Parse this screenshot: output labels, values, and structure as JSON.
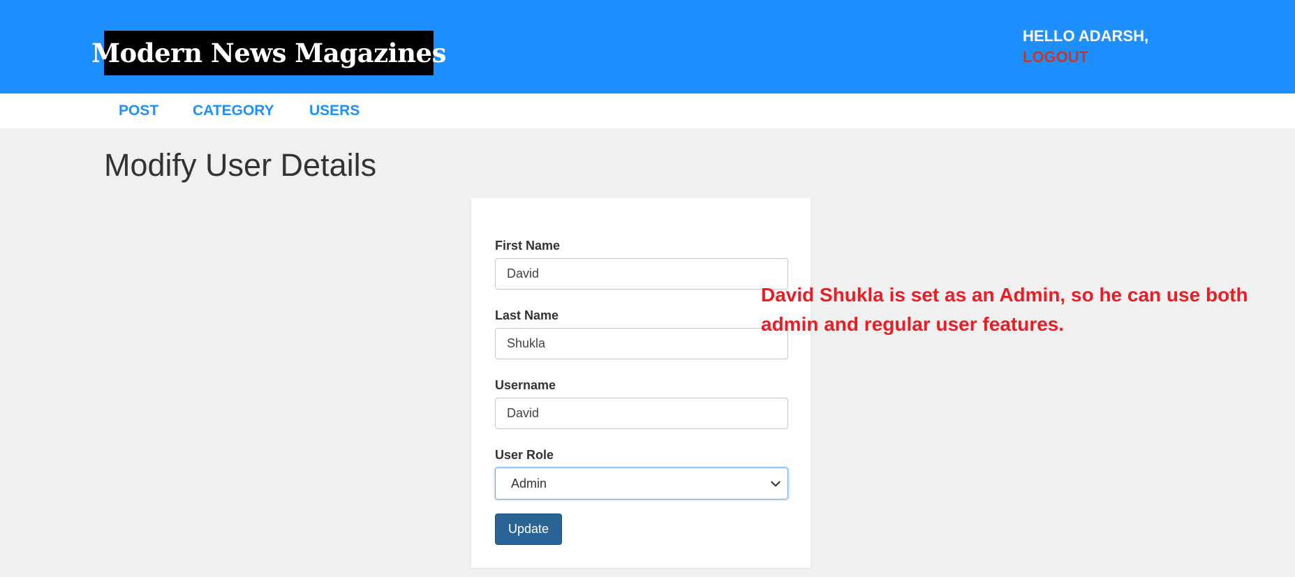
{
  "header": {
    "logo": "Modern News Magazines",
    "greeting": "HELLO ADARSH,",
    "logout": "LOGOUT"
  },
  "nav": {
    "items": [
      {
        "label": "POST"
      },
      {
        "label": "CATEGORY"
      },
      {
        "label": "USERS"
      }
    ]
  },
  "page": {
    "title": "Modify User Details"
  },
  "form": {
    "first_name": {
      "label": "First Name",
      "value": "David"
    },
    "last_name": {
      "label": "Last Name",
      "value": "Shukla"
    },
    "username": {
      "label": "Username",
      "value": "David"
    },
    "user_role": {
      "label": "User Role",
      "value": "Admin"
    },
    "submit": "Update"
  },
  "annotation": {
    "text": "David Shukla is set as an Admin, so he can use both admin and regular user features."
  },
  "colors": {
    "header_bg": "#1e8fff",
    "logout": "#c0392b",
    "nav_link": "#1e8fff",
    "button": "#2a6496",
    "annotation": "#ed1c24"
  },
  "icons": {
    "select": "chevron-down-icon"
  }
}
